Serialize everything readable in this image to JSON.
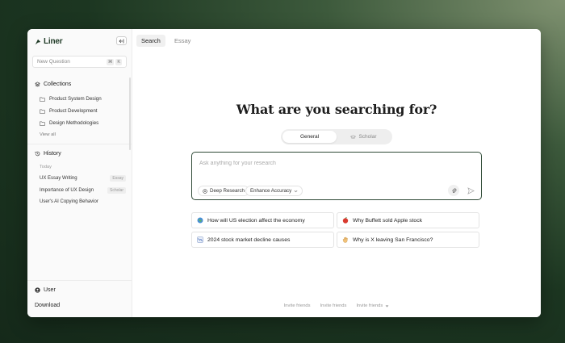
{
  "sidebar": {
    "logo_text": "Liner",
    "new_question": {
      "placeholder": "New Question",
      "keys": [
        "⌘",
        "K"
      ]
    },
    "collections": {
      "title": "Collections",
      "items": [
        {
          "label": "Product System Design"
        },
        {
          "label": "Product Development"
        },
        {
          "label": "Design Methodologies"
        }
      ],
      "view_all": "View all"
    },
    "history": {
      "title": "History",
      "group_label": "Today",
      "items": [
        {
          "label": "UX Essay Writing",
          "badge": "Essay"
        },
        {
          "label": "Importance of UX Design",
          "badge": "Scholar"
        },
        {
          "label": "User's AI Copying Behavior",
          "badge": ""
        }
      ]
    },
    "user_label": "User",
    "download_label": "Download"
  },
  "tabs": [
    {
      "label": "Search",
      "active": true
    },
    {
      "label": "Essay",
      "active": false
    }
  ],
  "main": {
    "heading": "What are you searching for?",
    "modes": [
      {
        "label": "General",
        "active": true
      },
      {
        "label": "Scholar",
        "active": false
      }
    ],
    "search": {
      "placeholder": "Ask anything for your research",
      "deep_research": "Deep Research",
      "enhance_accuracy": "Enhance Accuracy"
    },
    "suggestions": [
      {
        "label": "How will US election affect the economy",
        "icon": "globe-icon"
      },
      {
        "label": "Why Buffett sold Apple stock",
        "icon": "apple-icon"
      },
      {
        "label": "2024 stock market decline causes",
        "icon": "chart-icon"
      },
      {
        "label": "Why is X leaving San Francisco?",
        "icon": "hand-icon"
      }
    ],
    "footer": [
      "Invite friends",
      "Invite friends",
      "Invite friends"
    ]
  },
  "colors": {
    "accent": "#2f4a36",
    "brand": "#1f3a26",
    "background_dark": "#15291a"
  }
}
